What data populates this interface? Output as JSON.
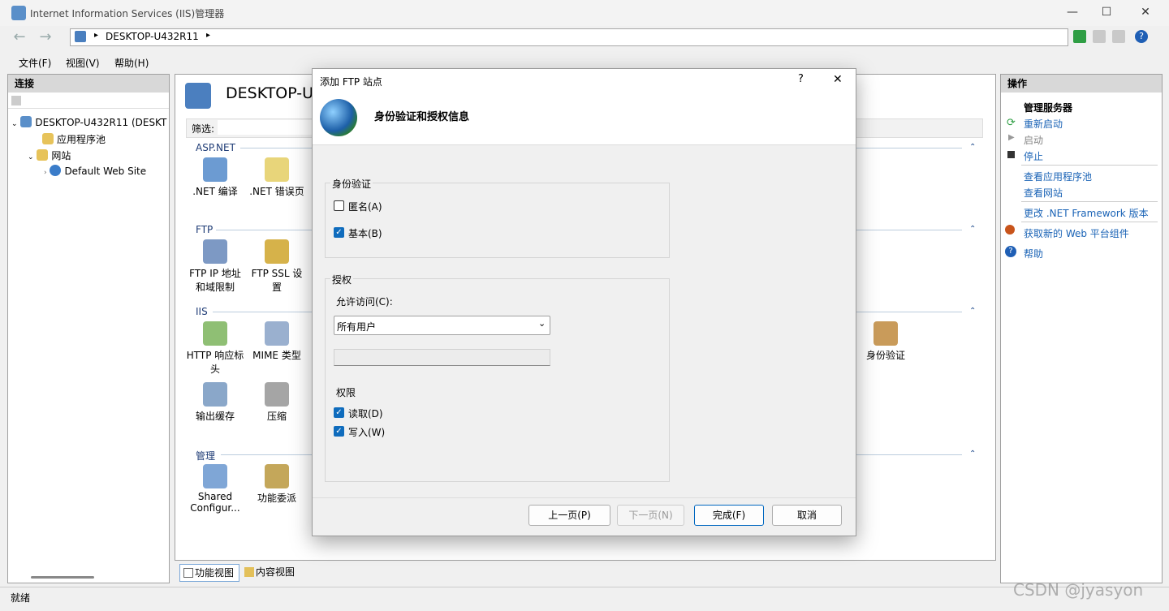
{
  "window": {
    "title": "Internet Information Services (IIS)管理器",
    "minimize": "—",
    "maximize": "☐",
    "close": "✕"
  },
  "address": {
    "path": "DESKTOP-U432R11",
    "sep": "▸"
  },
  "menu": [
    "文件(F)",
    "视图(V)",
    "帮助(H)"
  ],
  "left": {
    "title": "连接",
    "tree": [
      "DESKTOP-U432R11 (DESKT",
      "应用程序池",
      "网站",
      "Default Web Site"
    ]
  },
  "center": {
    "title": "DESKTOP-U",
    "filter_label": "筛选:",
    "sections": {
      "aspnet": "ASP.NET",
      "ftp": "FTP",
      "iis": "IIS",
      "manage": "管理"
    },
    "icons": {
      "net_compile": ".NET 编译",
      "net_error": ".NET 错误页",
      "ftp_ip_1": "FTP IP 地址",
      "ftp_ip_2": "和域限制",
      "ftp_ssl_1": "FTP SSL 设",
      "ftp_ssl_2": "置",
      "http_1": "HTTP 响应标",
      "http_2": "头",
      "mime": "MIME 类型",
      "auth": "身份验证",
      "output": "输出缓存",
      "compress": "压缩",
      "shared_1": "Shared",
      "shared_2": "Configur...",
      "delegation": "功能委派"
    },
    "tabs": {
      "feature": "功能视图",
      "content": "内容视图"
    }
  },
  "right": {
    "title": "操作",
    "manage_server": "管理服务器",
    "restart": "重新启动",
    "start": "启动",
    "stop": "停止",
    "view_pools": "查看应用程序池",
    "view_sites": "查看网站",
    "change_net": "更改 .NET Framework 版本",
    "get_components": "获取新的 Web 平台组件",
    "help": "帮助"
  },
  "status": {
    "text": "就绪",
    "watermark": "CSDN @jyasyon"
  },
  "dialog": {
    "title": "添加 FTP 站点",
    "help": "?",
    "close": "✕",
    "heading": "身份验证和授权信息",
    "auth_group": "身份验证",
    "anonymous": "匿名(A)",
    "basic": "基本(B)",
    "authz_group": "授权",
    "allow_access": "允许访问(C):",
    "allow_value": "所有用户",
    "allow_text": "",
    "permissions": "权限",
    "read": "读取(D)",
    "write": "写入(W)",
    "anonymous_checked": false,
    "basic_checked": true,
    "read_checked": true,
    "write_checked": true,
    "btn_prev": "上一页(P)",
    "btn_next": "下一页(N)",
    "btn_finish": "完成(F)",
    "btn_cancel": "取消"
  }
}
